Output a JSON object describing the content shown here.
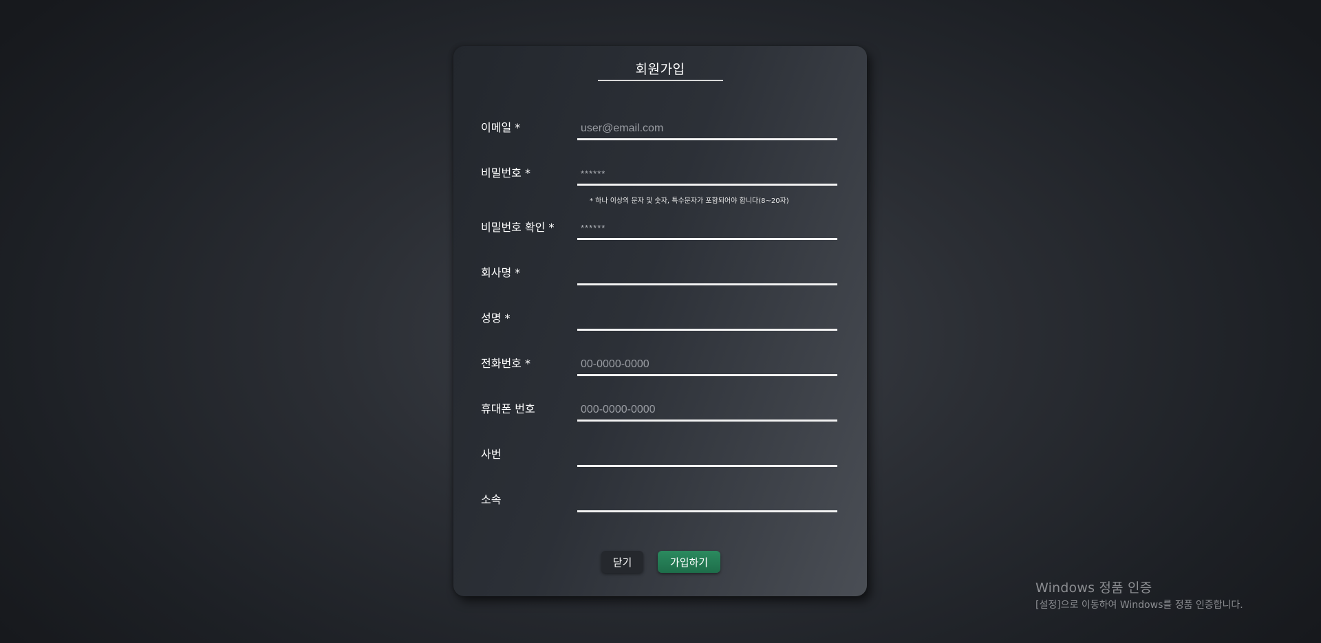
{
  "form": {
    "title": "회원가입",
    "fields": [
      {
        "label": "이메일 *",
        "placeholder": "user@email.com",
        "value": ""
      },
      {
        "label": "비밀번호 *",
        "placeholder": "******",
        "value": "",
        "hint": "* 하나 이상의 문자 및 숫자, 특수문자가 포함되어야 합니다(8~20자)"
      },
      {
        "label": "비밀번호 확인 *",
        "placeholder": "******",
        "value": ""
      },
      {
        "label": "회사명 *",
        "placeholder": "",
        "value": ""
      },
      {
        "label": "성명 *",
        "placeholder": "",
        "value": ""
      },
      {
        "label": "전화번호 *",
        "placeholder": "00-0000-0000",
        "value": ""
      },
      {
        "label": "휴대폰 번호",
        "placeholder": "000-0000-0000",
        "value": ""
      },
      {
        "label": "사번",
        "placeholder": "",
        "value": ""
      },
      {
        "label": "소속",
        "placeholder": "",
        "value": ""
      }
    ],
    "buttons": {
      "close_label": "닫기",
      "submit_label": "가입하기"
    }
  },
  "watermark": {
    "title": "Windows 정품 인증",
    "subtitle": "[설정]으로 이동하여 Windows를 정품 인증합니다."
  },
  "colors": {
    "submit_button": "#1e7a52",
    "close_button": "#25282d",
    "input_underline": "#f2f2f2"
  }
}
